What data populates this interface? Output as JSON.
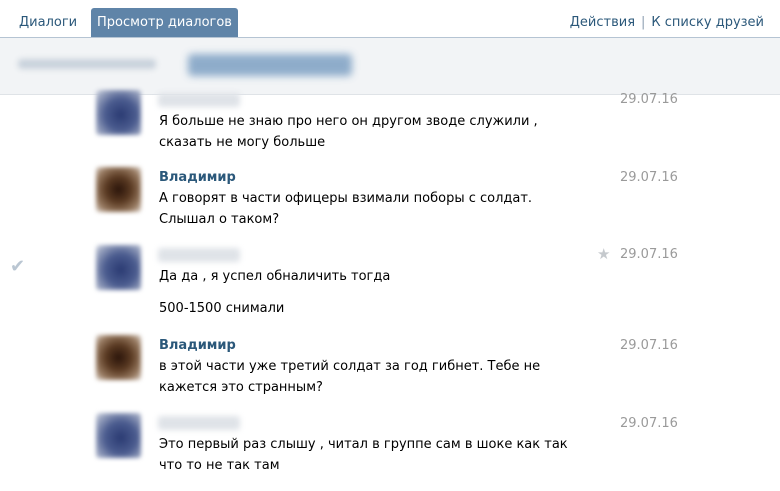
{
  "tabs": {
    "dialogs": "Диалоги",
    "view_dialogs": "Просмотр диалогов"
  },
  "header_actions": {
    "actions": "Действия",
    "separator": "|",
    "friends_list": "К списку друзей"
  },
  "messages": [
    {
      "author": "",
      "text": "Я больше не знаю про него он другом зводе служили , сказать не могу больше",
      "date": "29.07.16"
    },
    {
      "author": "Владимир",
      "text": "А говорят в части офицеры взимали поборы с солдат. Слышал о таком?",
      "date": "29.07.16"
    },
    {
      "author": "",
      "text": "Да да , я успел обналичить тогда",
      "text2": "500-1500 снимали",
      "date": "29.07.16",
      "selected": true,
      "starred": false
    },
    {
      "author": "Владимир",
      "text": "в этой части уже третий солдат за год гибнет. Тебе не кажется это странным?",
      "date": "29.07.16"
    },
    {
      "author": "",
      "text": "Это первый раз слышу , читал в группе сам в шоке как так что то не так там",
      "date": "29.07.16"
    }
  ],
  "icons": {
    "check": "✔",
    "star": "★"
  },
  "colors": {
    "link": "#2b587a",
    "active_tab": "#5f84a8",
    "date": "#9a9a9a"
  }
}
